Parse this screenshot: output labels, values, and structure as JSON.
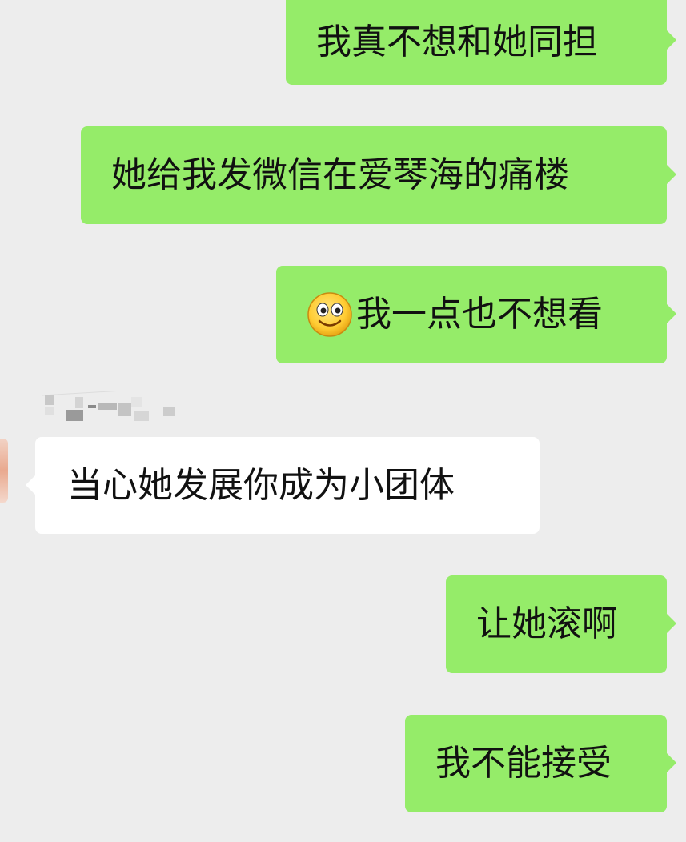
{
  "chat": {
    "messages": [
      {
        "direction": "outgoing",
        "text": "我真不想和她同担"
      },
      {
        "direction": "outgoing",
        "text": "她给我发微信在爱琴海的痛楼"
      },
      {
        "direction": "outgoing",
        "emoji": "smile-emoji",
        "text": "我一点也不想看"
      },
      {
        "direction": "incoming",
        "text": "当心她发展你成为小团体"
      },
      {
        "direction": "outgoing",
        "text": "让她滚啊"
      },
      {
        "direction": "outgoing",
        "text": "我不能接受"
      }
    ]
  },
  "colors": {
    "background": "#ededed",
    "outgoing_bubble": "#95ec69",
    "incoming_bubble": "#ffffff",
    "text": "#111111"
  },
  "icons": {
    "emoji": "smile-emoji"
  }
}
